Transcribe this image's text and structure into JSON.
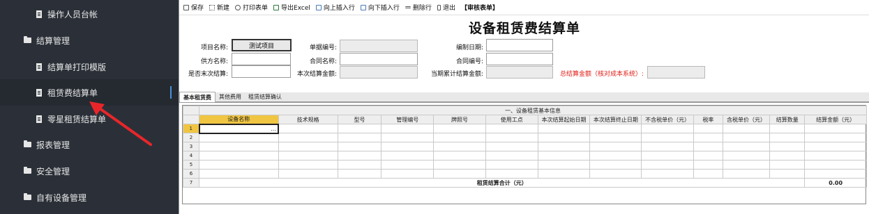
{
  "sidebar": {
    "items": [
      {
        "label": "操作人员台帐",
        "icon": "document-icon",
        "level": 2
      },
      {
        "label": "结算管理",
        "icon": "folder-open-icon",
        "level": 1
      },
      {
        "label": "结算单打印模版",
        "icon": "document-icon",
        "level": 2
      },
      {
        "label": "租赁费结算单",
        "icon": "document-icon",
        "level": 2,
        "active": true
      },
      {
        "label": "零星租赁结算单",
        "icon": "document-icon",
        "level": 2
      },
      {
        "label": "报表管理",
        "icon": "folder-open-icon",
        "level": 1
      },
      {
        "label": "安全管理",
        "icon": "folder-open-icon",
        "level": 1
      },
      {
        "label": "自有设备管理",
        "icon": "folder-open-icon",
        "level": 1
      }
    ]
  },
  "toolbar": {
    "items": [
      {
        "label": "保存",
        "icon": "save-icon"
      },
      {
        "label": "新建",
        "icon": "new-icon"
      },
      {
        "label": "打印表单",
        "icon": "print-icon"
      },
      {
        "label": "导出Excel",
        "icon": "export-excel-icon"
      },
      {
        "label": "向上插入行",
        "icon": "insert-above-icon"
      },
      {
        "label": "向下插入行",
        "icon": "insert-below-icon"
      },
      {
        "label": "删除行",
        "icon": "delete-row-icon"
      },
      {
        "label": "退出",
        "icon": "exit-icon"
      },
      {
        "label": "【审核表单】",
        "icon": ""
      }
    ]
  },
  "form": {
    "title": "设备租赁费结算单",
    "project_name_label": "项目名称:",
    "project_name_value": "测试项目",
    "doc_no_label": "单据编号:",
    "doc_no_value": "",
    "date_label": "编制日期:",
    "date_value": "",
    "supplier_label": "供方名称:",
    "supplier_value": "",
    "contract_name_label": "合同名称:",
    "contract_name_value": "",
    "contract_no_label": "合同编号:",
    "contract_no_value": "",
    "is_final_label": "是否末次结算:",
    "is_final_value": "",
    "current_amount_label": "本次结算金额:",
    "current_amount_value": "",
    "cumulative_label": "当期累计结算金额:",
    "cumulative_value": "",
    "total_label": "总结算金额（核对成本系统）:",
    "total_value": ""
  },
  "tabs": [
    {
      "label": "基本租赁费",
      "active": true
    },
    {
      "label": "其他费用",
      "active": false
    },
    {
      "label": "租赁结算确认",
      "active": false
    }
  ],
  "grid": {
    "section_title": "一、设备租赁基本信息",
    "columns": [
      "设备名称",
      "技术规格",
      "型号",
      "管理编号",
      "牌照号",
      "使用工点",
      "本次结算起始日期",
      "本次结算终止日期",
      "不含税单价（元）",
      "税率",
      "含税单价（元）",
      "结算数量",
      "结算金额（元）"
    ],
    "row_numbers": [
      "1",
      "2",
      "3",
      "4",
      "5",
      "6",
      "7"
    ],
    "ellipsis": "...",
    "summary_label": "租赁结算合计（元）",
    "summary_value": "0.00"
  },
  "colors": {
    "sidebar_bg": "#2b3038",
    "sidebar_active_bg": "#252a31",
    "active_indicator": "#4a90d9",
    "header_highlight": "#f0c542",
    "total_label_red": "#e0201a"
  }
}
